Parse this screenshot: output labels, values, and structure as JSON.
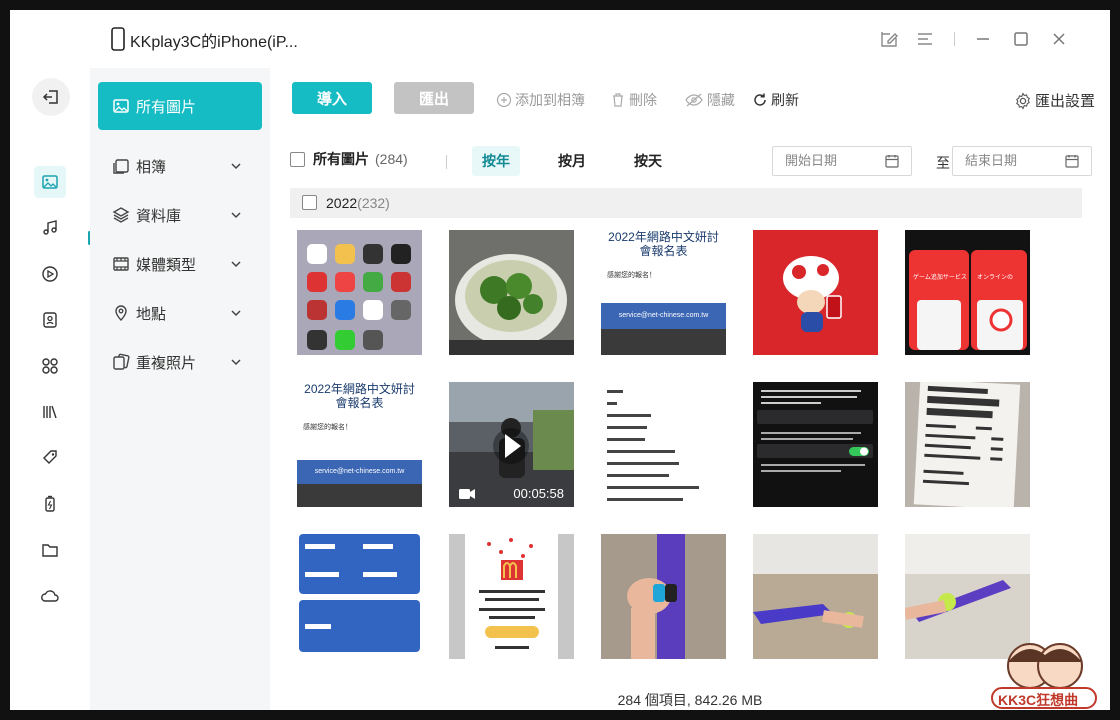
{
  "window": {
    "title": "KKplay3C的iPhone(iP..."
  },
  "toolbar": {
    "import_label": "導入",
    "export_label": "匯出",
    "add_album_label": "添加到相簿",
    "delete_label": "刪除",
    "hide_label": "隱藏",
    "refresh_label": "刷新",
    "export_settings_label": "匯出設置"
  },
  "categories": [
    {
      "label": "所有圖片",
      "icon": "image-icon",
      "active": true
    },
    {
      "label": "相簿",
      "icon": "album-icon"
    },
    {
      "label": "資料庫",
      "icon": "layers-icon"
    },
    {
      "label": "媒體類型",
      "icon": "film-icon"
    },
    {
      "label": "地點",
      "icon": "location-pin-icon"
    },
    {
      "label": "重複照片",
      "icon": "duplicate-icon"
    }
  ],
  "rail": [
    "back-icon",
    "photos-icon",
    "music-icon",
    "video-icon",
    "contacts-icon",
    "apps-icon",
    "books-icon",
    "tag-icon",
    "battery-icon",
    "folder-icon",
    "cloud-icon"
  ],
  "filter": {
    "all_label": "所有圖片",
    "all_count": "(284)",
    "tabs": [
      "按年",
      "按月",
      "按天"
    ],
    "start_date_placeholder": "開始日期",
    "to_label": "至",
    "end_date_placeholder": "結束日期"
  },
  "group": {
    "year": "2022",
    "count": "(232)"
  },
  "video": {
    "duration": "00:05:58"
  },
  "thumb_text": {
    "form_title": "2022年網路中文妍討會報名表",
    "form_thanks": "感謝您的報名！",
    "form_email": "service@net-chinese.com.tw",
    "game_service": "ゲーム追加サービス",
    "game_online": "オンラインの"
  },
  "status": {
    "summary": "284 個項目, 842.26 MB"
  },
  "watermark": {
    "text": "KK3C狂想曲"
  },
  "colors": {
    "accent": "#16bcc4",
    "sidebar_bg": "#f5f6f7"
  }
}
